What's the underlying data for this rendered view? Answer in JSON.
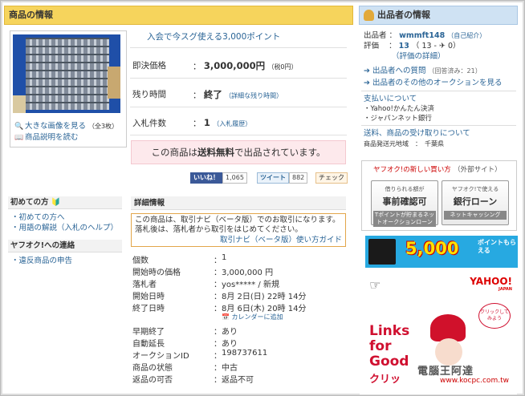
{
  "header": {
    "title": "商品の情報"
  },
  "photo": {
    "enlarge": "大きな画像を見る",
    "enlarge_count": "（全3枚）",
    "desc": "商品説明を読む"
  },
  "promo": {
    "text": "入会で今スグ使える3,000ポイント"
  },
  "price": {
    "label": "即決価格",
    "sep": "：",
    "value": "3,000,000円",
    "note": "（税0円）"
  },
  "remaining": {
    "label": "残り時間",
    "sep": "：",
    "value": "終了",
    "link": "（詳細な残り時間）"
  },
  "bids": {
    "label": "入札件数",
    "sep": "：",
    "value": "1",
    "link": "（入札履歴）"
  },
  "shipping": {
    "pre": "この商品は",
    "bold": "送料無料",
    "post": "で出品されています。"
  },
  "social": {
    "like": "いいね！",
    "like_count": "1,065",
    "tweet": "ツイート",
    "tweet_count": "882",
    "check": "チェック"
  },
  "sidebar": {
    "h1": "初めての方",
    "items1": [
      "・初めての方へ",
      "・用語の解説（入札のヘルプ）"
    ],
    "h2": "ヤフオク!への連絡",
    "items2": [
      "・違反商品の申告"
    ]
  },
  "details": {
    "title": "詳細情報",
    "notice": "この商品は、取引ナビ（ベータ版）でのお取引になります。落札後は、落札者から取引をはじめてください。",
    "guide": "取引ナビ（ベータ版）使い方ガイド",
    "rows": [
      {
        "label": "個数",
        "value": "1"
      },
      {
        "label": "開始時の価格",
        "value": "3,000,000 円"
      },
      {
        "label": "落札者",
        "value": "yos***** / 新規"
      },
      {
        "label": "開始日時",
        "value": "8月 2日(日) 22時 14分"
      },
      {
        "label": "終了日時",
        "value": "8月 6日(木) 20時 14分"
      },
      {
        "label": "早期終了",
        "value": "あり"
      },
      {
        "label": "自動延長",
        "value": "あり"
      },
      {
        "label": "オークションID",
        "value": "198737611"
      },
      {
        "label": "商品の状態",
        "value": "中古"
      },
      {
        "label": "返品の可否",
        "value": "返品不可"
      }
    ],
    "calendar": "カレンダーに追加",
    "colon": "："
  },
  "seller": {
    "title": "出品者の情報",
    "id_label": "出品者",
    "id_sep": "：",
    "id": "wmmft148",
    "intro": "（自己紹介）",
    "rating_label": "評価",
    "rating_sep": "：",
    "rating": "13",
    "rating_detail": "（ 13 - ✈ 0）",
    "rating_link": "（評価の詳細）",
    "question": "出品者への質問",
    "answered": "（回答済み：21）",
    "other": "出品者のその他のオークションを見る",
    "pay_h": "支払いについて",
    "pay": [
      "・Yahoo!かんたん決済",
      "・ジャパンネット銀行"
    ],
    "ship_h": "送料、商品の受け取りについて",
    "ship_from": "商品発送元地域　：　千葉県"
  },
  "newway": {
    "title": "ヤフオク!の新しい買い方",
    "sub": "（外部サイト）",
    "b1": {
      "a": "借りられる額が",
      "b": "事前確認可",
      "c": "Tポイントが貯まるネットオークションローン"
    },
    "b2": {
      "a": "ヤフオク!で使える",
      "b": "銀行ローン",
      "c": "ネットキャッシング"
    }
  },
  "banner1": {
    "num": "5,000",
    "sub": "ポイントもらえる"
  },
  "banner2": {
    "logo": "YAHOO!",
    "logo_sub": "JAPAN",
    "slogan": "Links for Good",
    "bubble": "クリックしてみよう",
    "foot": "クリッ"
  },
  "watermark": {
    "a": "電腦王阿達",
    "b": "www.kocpc.com.tw"
  }
}
